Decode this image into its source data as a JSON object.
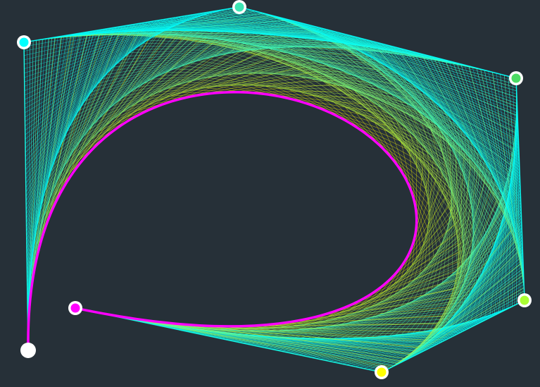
{
  "canvas": {
    "background": "#263038"
  },
  "bezier": {
    "curve_color": "#ff00ff",
    "line_colors": [
      "#00ffff",
      "#7dff7d",
      "#ffff00"
    ],
    "control_point_fill": "#ffffff",
    "control_points": [
      {
        "name": "p0",
        "color": "#ffffff"
      },
      {
        "name": "p1",
        "color": "#00ffff"
      },
      {
        "name": "p2",
        "color": "#3ce6b4"
      },
      {
        "name": "p3",
        "color": "#4cdc64"
      },
      {
        "name": "p4",
        "color": "#aaff33"
      },
      {
        "name": "p5",
        "color": "#ffff00"
      },
      {
        "name": "p6",
        "color": "#ff00ff"
      }
    ]
  }
}
